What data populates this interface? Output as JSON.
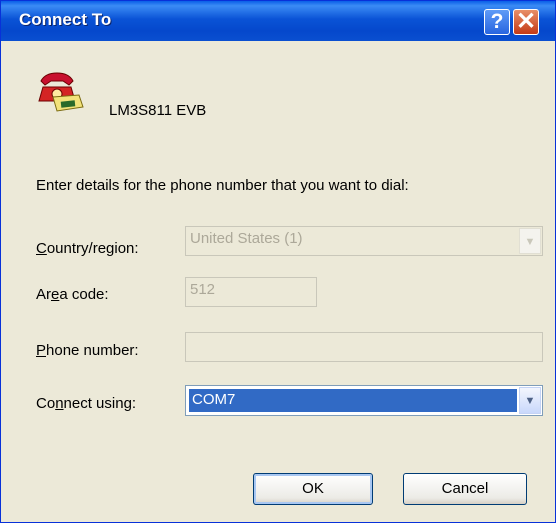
{
  "window": {
    "title": "Connect To"
  },
  "titlebar": {
    "help_glyph": "?",
    "close_glyph": "✕"
  },
  "connection": {
    "icon": "telephone-icon",
    "name": "LM3S811 EVB"
  },
  "prompt": "Enter details for the phone number that you want to dial:",
  "fields": {
    "country": {
      "label_pre": "",
      "label_key": "C",
      "label_post": "ountry/region:",
      "value": "United States (1)",
      "enabled": false
    },
    "area_code": {
      "label_pre": "Ar",
      "label_key": "e",
      "label_post": "a code:",
      "value": "512",
      "enabled": false
    },
    "phone": {
      "label_pre": "",
      "label_key": "P",
      "label_post": "hone number:",
      "value": "",
      "enabled": false
    },
    "connect_using": {
      "label_pre": "Co",
      "label_key": "n",
      "label_post": "nect using:",
      "value": "COM7",
      "enabled": true
    }
  },
  "buttons": {
    "ok": "OK",
    "cancel": "Cancel"
  },
  "colors": {
    "titlebar": "#0a53d6",
    "selection": "#316ac5",
    "dialog_bg": "#ece9d8"
  }
}
